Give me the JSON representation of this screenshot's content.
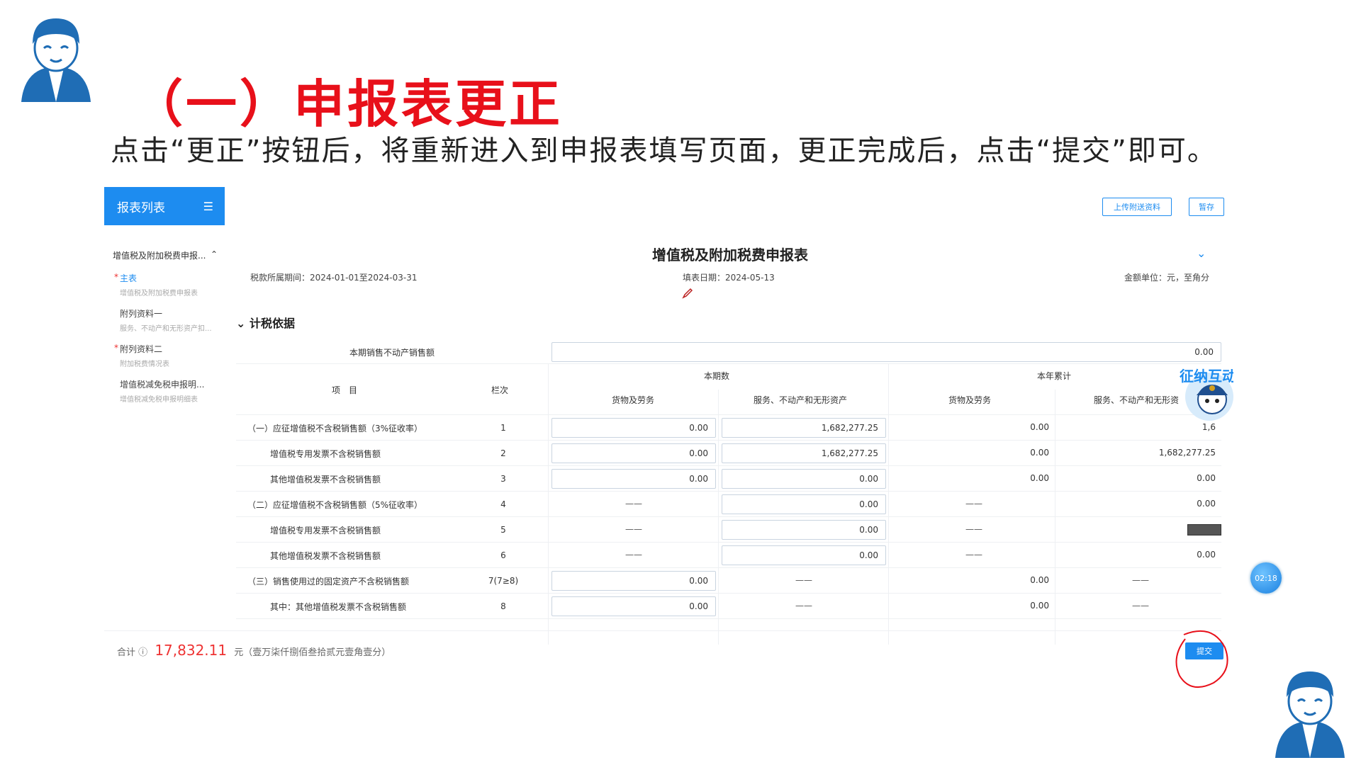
{
  "slide": {
    "title": "（一）申报表更正",
    "subtitle": "点击“更正”按钮后，将重新进入到申报表填写页面，更正完成后，点击“提交”即可。"
  },
  "sidebar": {
    "header": "报表列表",
    "group_label": "增值税及附加税费申报...",
    "items": [
      {
        "title": "主表",
        "sub": "增值税及附加税费申报表",
        "required": true,
        "active": true
      },
      {
        "title": "附列资料一",
        "sub": "服务、不动产和无形资产扣...",
        "required": false,
        "active": false
      },
      {
        "title": "附列资料二",
        "sub": "附加税费情况表",
        "required": true,
        "active": false
      },
      {
        "title": "增值税减免税申报明...",
        "sub": "增值税减免税申报明细表",
        "required": false,
        "active": false
      }
    ]
  },
  "toolbar": {
    "upload_label": "上传附送资料",
    "save_label": "暂存"
  },
  "form": {
    "title": "增值税及附加税费申报表",
    "period": "税款所属期间：2024-01-01至2024-03-31",
    "fill_date": "填表日期：2024-05-13",
    "unit": "金额单位：元，至角分",
    "section": "计税依据",
    "realestate_label": "本期销售不动产销售额",
    "realestate_value": "0.00"
  },
  "table": {
    "headers": {
      "item": "项　目",
      "col": "栏次",
      "current": "本期数",
      "ytd": "本年累计",
      "goods": "货物及劳务",
      "services": "服务、不动产和无形资产",
      "goods_ytd": "货物及劳务",
      "services_ytd": "服务、不动产和无形资"
    },
    "rows": [
      {
        "label": "（一）应征增值税不含税销售额（3%征收率）",
        "col": "1",
        "c1": "0.00",
        "c2": "1,682,277.25",
        "c3": "0.00",
        "c4": "1,6"
      },
      {
        "label": "增值税专用发票不含税销售额",
        "col": "2",
        "c1": "0.00",
        "c2": "1,682,277.25",
        "c3": "0.00",
        "c4": "1,682,277.25"
      },
      {
        "label": "其他增值税发票不含税销售额",
        "col": "3",
        "c1": "0.00",
        "c2": "0.00",
        "c3": "0.00",
        "c4": "0.00"
      },
      {
        "label": "（二）应征增值税不含税销售额（5%征收率）",
        "col": "4",
        "c1": "——",
        "c2": "0.00",
        "c3": "——",
        "c4": "0.00"
      },
      {
        "label": "增值税专用发票不含税销售额",
        "col": "5",
        "c1": "——",
        "c2": "0.00",
        "c3": "——",
        "c4": ""
      },
      {
        "label": "其他增值税发票不含税销售额",
        "col": "6",
        "c1": "——",
        "c2": "0.00",
        "c3": "——",
        "c4": "0.00"
      },
      {
        "label": "（三）销售使用过的固定资产不含税销售额",
        "col": "7(7≥8)",
        "c1": "0.00",
        "c2": "——",
        "c3": "0.00",
        "c4": "——"
      },
      {
        "label": "其中：其他增值税发票不含税销售额",
        "col": "8",
        "c1": "0.00",
        "c2": "——",
        "c3": "0.00",
        "c4": "——"
      }
    ]
  },
  "footer": {
    "total_label": "合计",
    "total_amount": "17,832.11",
    "total_unit": "元（壹万柒仟捌佰叁拾贰元壹角壹分）",
    "submit_label": "提交"
  },
  "badge": {
    "text": "征纳互动"
  },
  "timer": "02:18",
  "colors": {
    "accent": "#1d8cf0",
    "title_red": "#e8101a",
    "mascot_blue": "#1f6db5"
  }
}
